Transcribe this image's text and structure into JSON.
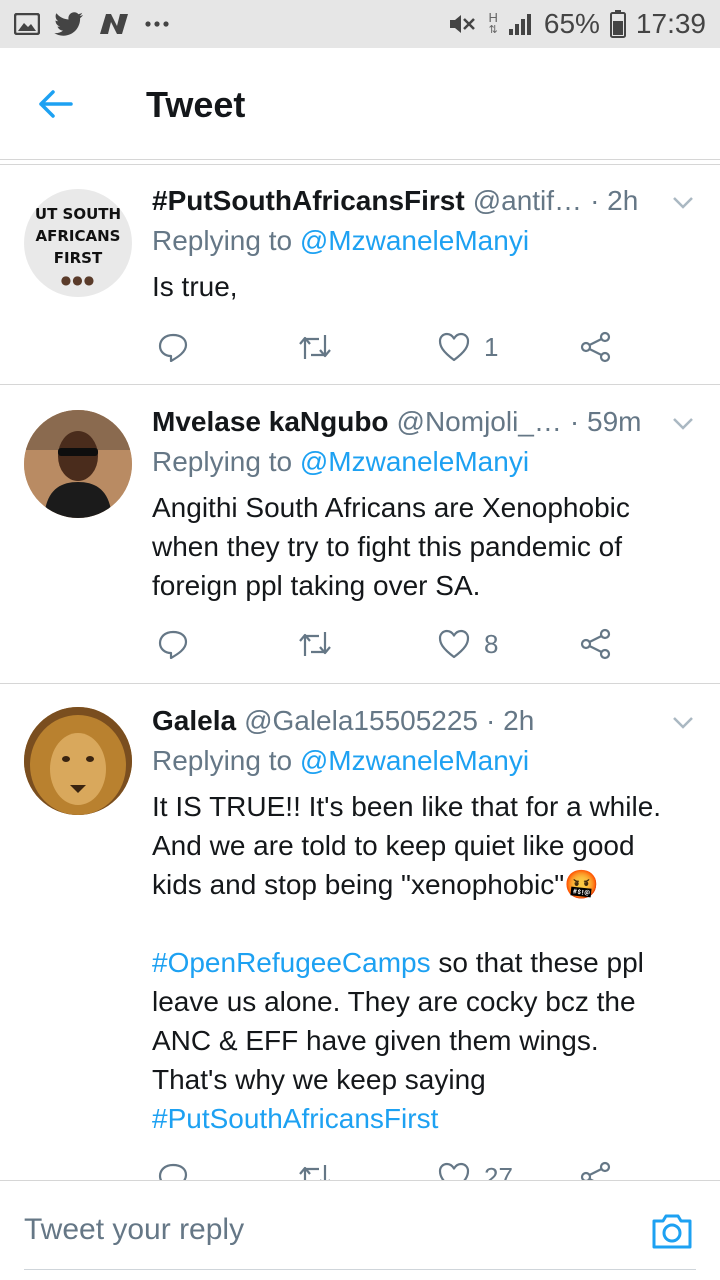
{
  "status_bar": {
    "battery": "65%",
    "time": "17:39",
    "network": "H",
    "left_icons": [
      "gallery-icon",
      "twitter-bird-icon",
      "n-app-icon",
      "more-dots-icon"
    ],
    "right_icons": [
      "mute-icon",
      "network-type-icon",
      "signal-icon",
      "battery-icon"
    ]
  },
  "header": {
    "title": "Tweet",
    "back_icon": "back-arrow-icon"
  },
  "tweets": [
    {
      "avatar_text": [
        "UT SOUTH",
        "AFRICANS",
        "FIRST"
      ],
      "name": "#PutSouthAfricansFirst",
      "handle": "@antif…",
      "time": "· 2h",
      "replying_prefix": "Replying to ",
      "replying_to": "@MzwaneleManyi",
      "body": [
        "Is true,"
      ],
      "likes": "1"
    },
    {
      "name": "Mvelase kaNgubo",
      "handle": "@Nomjoli_…",
      "time": "· 59m",
      "replying_prefix": "Replying to ",
      "replying_to": "@MzwaneleManyi",
      "body": [
        "Angithi South Africans are Xenophobic",
        "when they try to fight this pandemic of",
        "foreign ppl taking over SA."
      ],
      "likes": "8"
    },
    {
      "name": "Galela",
      "handle": "@Galela15505225",
      "time": "· 2h",
      "replying_prefix": "Replying to ",
      "replying_to": "@MzwaneleManyi",
      "body": [
        "It IS TRUE!! It's been like that for a while.",
        "And we are told to keep quiet like good",
        "kids and stop being \"xenophobic\"🤬",
        "",
        "#OpenRefugeeCamps",
        " so that these ppl",
        "leave us alone. They are cocky bcz the",
        "ANC & EFF have given them wings.",
        "That's why we keep saying",
        "#PutSouthAfricansFirst"
      ],
      "likes": "27"
    }
  ],
  "reply_bar": {
    "placeholder": "Tweet your reply",
    "camera_icon": "camera-icon"
  },
  "colors": {
    "accent": "#1da1f2",
    "secondary_text": "#657786",
    "primary_text": "#14171a",
    "divider": "#d6d6d6",
    "status_bar_bg": "#e6e6e6"
  }
}
